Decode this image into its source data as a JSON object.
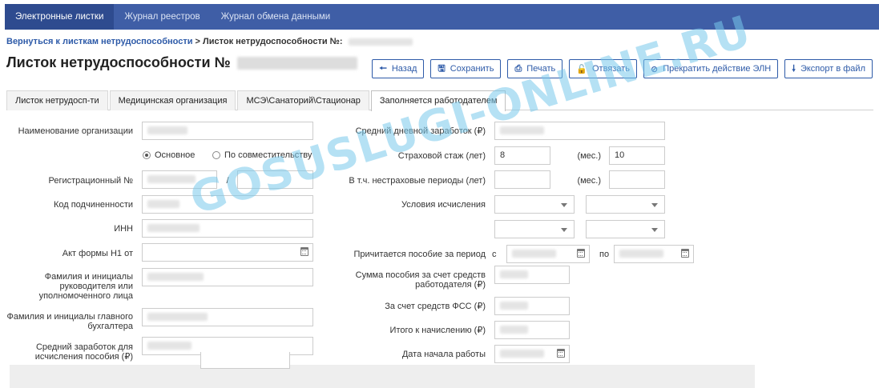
{
  "nav": {
    "items": [
      "Электронные листки",
      "Журнал реестров",
      "Журнал обмена данными"
    ],
    "active_index": 0
  },
  "breadcrumb": {
    "back_link": "Вернуться к листкам нетрудоспособности",
    "separator": ">",
    "current": "Листок нетрудоспособности №:"
  },
  "title": "Листок нетрудоспособности №",
  "toolbar": {
    "back": "Назад",
    "save": "Сохранить",
    "print": "Печать",
    "unbind": "Отвязать",
    "terminate": "Прекратить действие ЭЛН",
    "export": "Экспорт в файл"
  },
  "tabs": [
    "Листок нетрудосп-ти",
    "Медицинская организация",
    "МСЭ\\Санаторий\\Стационар",
    "Заполняется работодателем"
  ],
  "active_tab": 3,
  "form_left": {
    "org_name_label": "Наименование организации",
    "radio_main": "Основное",
    "radio_part": "По совместительству",
    "radio_selected": "Основное",
    "reg_num_label": "Регистрационный №",
    "reg_sep": "/",
    "subordination_label": "Код подчиненности",
    "inn_label": "ИНН",
    "act_label": "Акт формы Н1 от",
    "head_label": "Фамилия и инициалы руководителя или уполномоченного лица",
    "accountant_label": "Фамилия и инициалы главного бухгалтера",
    "avg_earnings_label": "Средний заработок для исчисления пособия (₽)"
  },
  "form_right": {
    "daily_label": "Средний дневной заработок (₽)",
    "stage_label": "Страховой стаж (лет)",
    "stage_years": "8",
    "months_unit": "(мес.)",
    "stage_months": "10",
    "non_ins_label": "В т.ч. нестраховые периоды (лет)",
    "conditions_label": "Условия исчисления",
    "period_label": "Причитается пособие за период",
    "from_label": "с",
    "to_label": "по",
    "employer_sum_label": "Сумма пособия за счет средств работодателя (₽)",
    "fss_label": "За счет средств ФСС (₽)",
    "total_label": "Итого к начислению (₽)",
    "start_date_label": "Дата начала работы"
  },
  "watermark": "GOSUSLUGI-ONLINE.RU",
  "colors": {
    "nav_bg": "#3f5ea6",
    "accent": "#2d5aa8",
    "watermark": "#78c8eb"
  }
}
